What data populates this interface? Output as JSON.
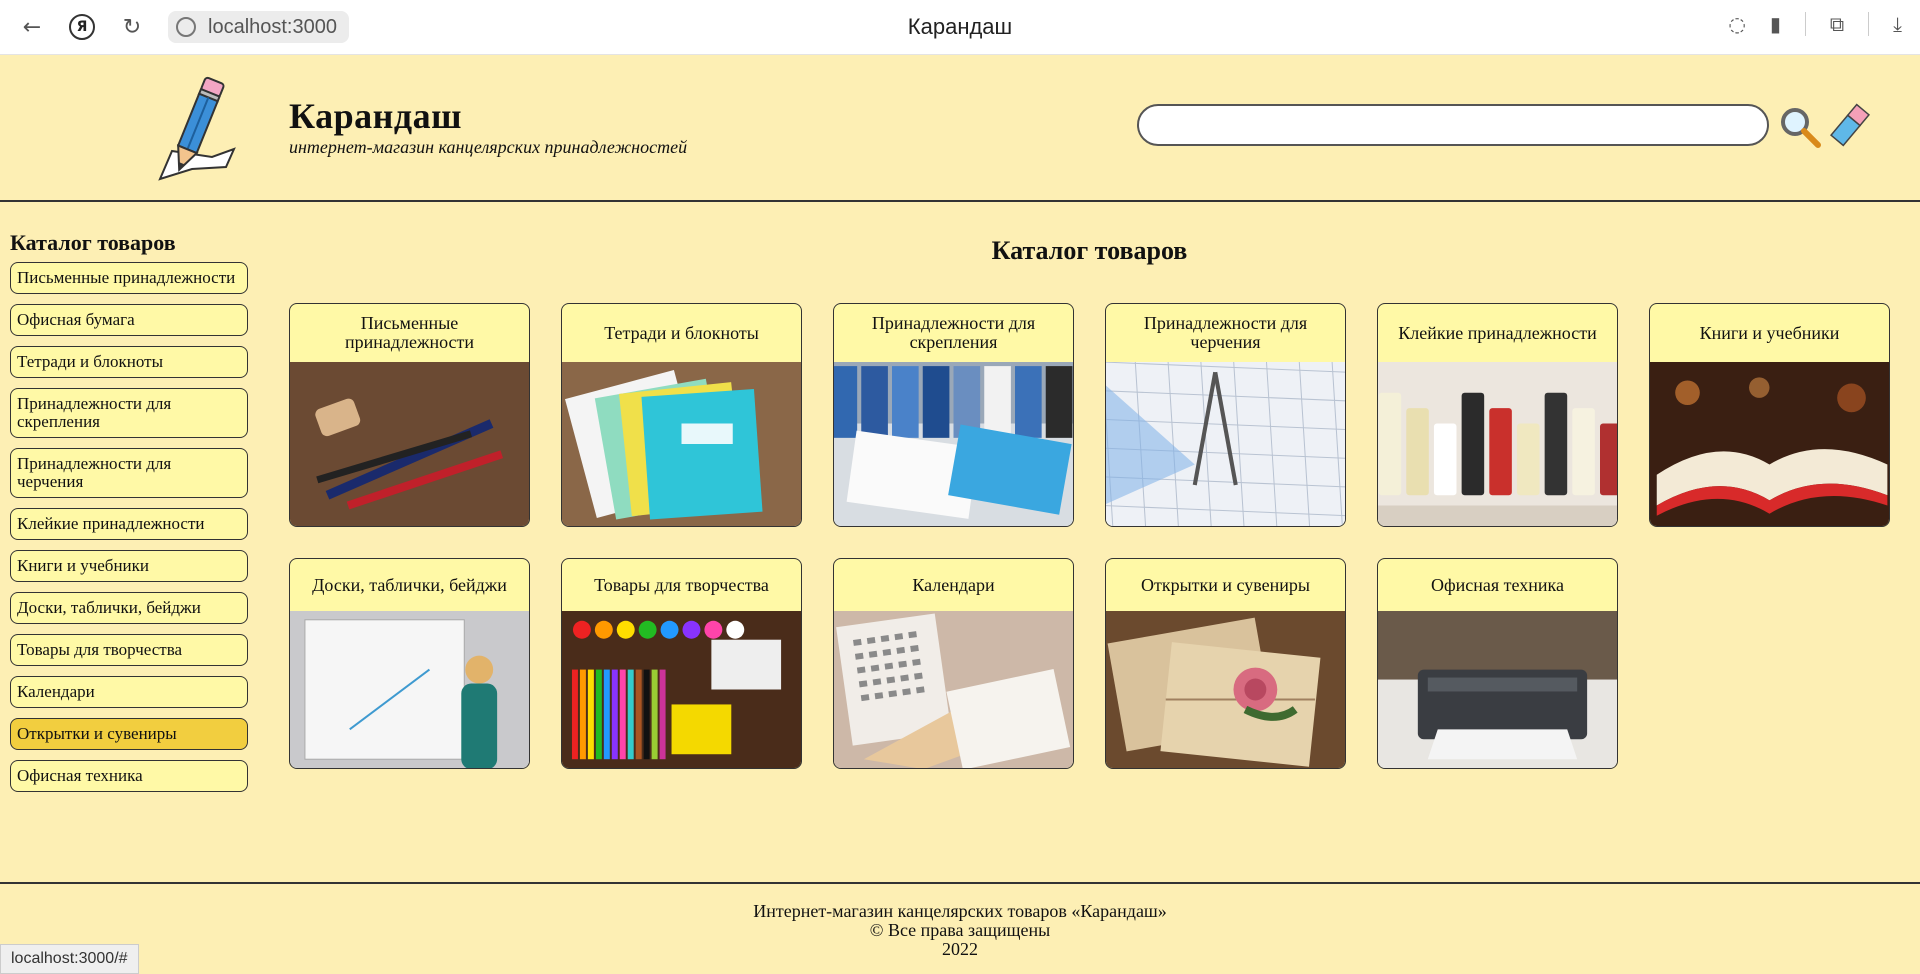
{
  "browser": {
    "url": "localhost:3000",
    "tab_title": "Карандаш",
    "status_url": "localhost:3000/#"
  },
  "header": {
    "title": "Карандаш",
    "subtitle": "интернет-магазин канцелярских принадлежностей",
    "search_value": ""
  },
  "sidebar": {
    "heading": "Каталог товаров",
    "items": [
      {
        "label": "Письменные принадлежности"
      },
      {
        "label": "Офисная бумага"
      },
      {
        "label": "Тетради и блокноты"
      },
      {
        "label": "Принадлежности для скрепления"
      },
      {
        "label": "Принадлежности для черчения"
      },
      {
        "label": "Клейкие принадлежности"
      },
      {
        "label": "Книги и учебники"
      },
      {
        "label": "Доски, таблички, бейджи"
      },
      {
        "label": "Товары для творчества"
      },
      {
        "label": "Календари"
      },
      {
        "label": "Открытки и сувениры",
        "active": true
      },
      {
        "label": "Офисная техника"
      }
    ]
  },
  "main": {
    "title": "Каталог товаров",
    "cards": [
      {
        "label": "Письменные принадлежности",
        "image": "pens-photo"
      },
      {
        "label": "Тетради и блокноты",
        "image": "notebooks-photo"
      },
      {
        "label": "Принадлежности для скрепления",
        "image": "binders-photo"
      },
      {
        "label": "Принадлежности для черчения",
        "image": "drafting-photo"
      },
      {
        "label": "Клейкие принадлежности",
        "image": "glue-photo"
      },
      {
        "label": "Книги и учебники",
        "image": "book-photo"
      },
      {
        "label": "Доски, таблички, бейджи",
        "image": "whiteboard-photo"
      },
      {
        "label": "Товары для творчества",
        "image": "art-supplies-photo"
      },
      {
        "label": "Календари",
        "image": "calendar-photo"
      },
      {
        "label": "Открытки и сувениры",
        "image": "postcards-photo"
      },
      {
        "label": "Офисная техника",
        "image": "printer-photo"
      }
    ]
  },
  "footer": {
    "line1": "Интернет-магазин канцелярских товаров «Карандаш»",
    "line2": "© Все права защищены",
    "line3": "2022"
  },
  "colors": {
    "page_bg": "#fdefb4",
    "button_bg": "#fff9a6",
    "active_bg": "#f2ce3f"
  }
}
